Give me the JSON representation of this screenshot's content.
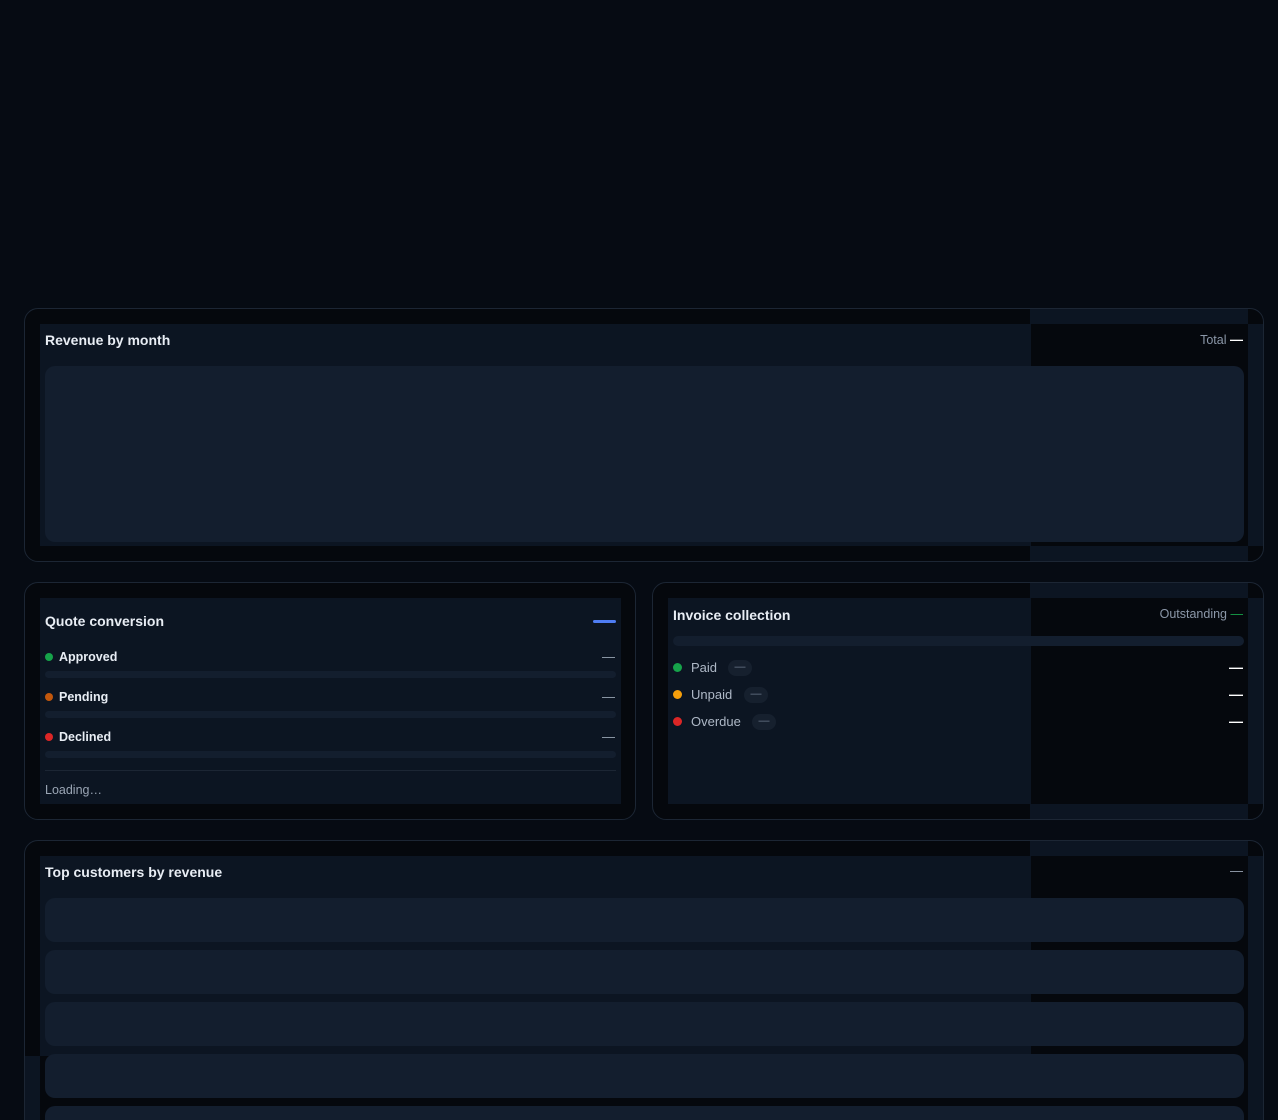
{
  "revenue": {
    "title": "Revenue by month",
    "total_label": "Total",
    "total_value": "—"
  },
  "quote_conversion": {
    "title": "Quote conversion",
    "rows": [
      {
        "label": "Approved",
        "value": "—",
        "color": "#16a34a"
      },
      {
        "label": "Pending",
        "value": "—",
        "color": "#c2570c"
      },
      {
        "label": "Declined",
        "value": "—",
        "color": "#dc2626"
      }
    ],
    "status": "Loading…",
    "accent": "#4f7df3"
  },
  "invoice_collection": {
    "title": "Invoice collection",
    "outstanding_label": "Outstanding",
    "outstanding_value": "—",
    "rows": [
      {
        "label": "Paid",
        "count": "—",
        "value": "—",
        "color": "#16a34a"
      },
      {
        "label": "Unpaid",
        "count": "—",
        "value": "—",
        "color": "#f59e0b"
      },
      {
        "label": "Overdue",
        "count": "—",
        "value": "—",
        "color": "#dc2626"
      }
    ]
  },
  "top_customers": {
    "title": "Top customers by revenue",
    "meta": "—"
  }
}
